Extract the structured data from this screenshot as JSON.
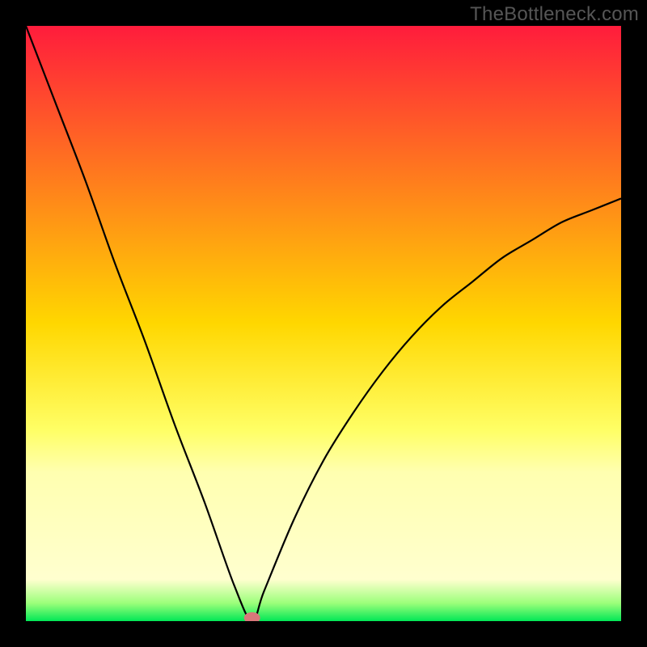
{
  "watermark": "TheBottleneck.com",
  "chart_data": {
    "type": "line",
    "title": "",
    "xlabel": "",
    "ylabel": "",
    "xlim": [
      0,
      100
    ],
    "ylim": [
      0,
      100
    ],
    "minimum_x": 38,
    "series": [
      {
        "name": "curve",
        "x": [
          0,
          5,
          10,
          15,
          20,
          25,
          30,
          35,
          38,
          40,
          45,
          50,
          55,
          60,
          65,
          70,
          75,
          80,
          85,
          90,
          95,
          100
        ],
        "y": [
          100,
          87,
          74,
          60,
          47,
          33,
          20,
          6,
          0,
          5,
          17,
          27,
          35,
          42,
          48,
          53,
          57,
          61,
          64,
          67,
          69,
          71
        ]
      }
    ],
    "marker": {
      "x": 38,
      "y": 0,
      "color": "#d9777a"
    },
    "gradient_stops": [
      {
        "offset": 0,
        "color": "#ff1c3c"
      },
      {
        "offset": 50,
        "color": "#ffd700"
      },
      {
        "offset": 68,
        "color": "#ffff66"
      },
      {
        "offset": 75,
        "color": "#ffffb0"
      },
      {
        "offset": 93,
        "color": "#ffffcf"
      },
      {
        "offset": 97,
        "color": "#9bff7a"
      },
      {
        "offset": 100,
        "color": "#00e756"
      }
    ]
  }
}
